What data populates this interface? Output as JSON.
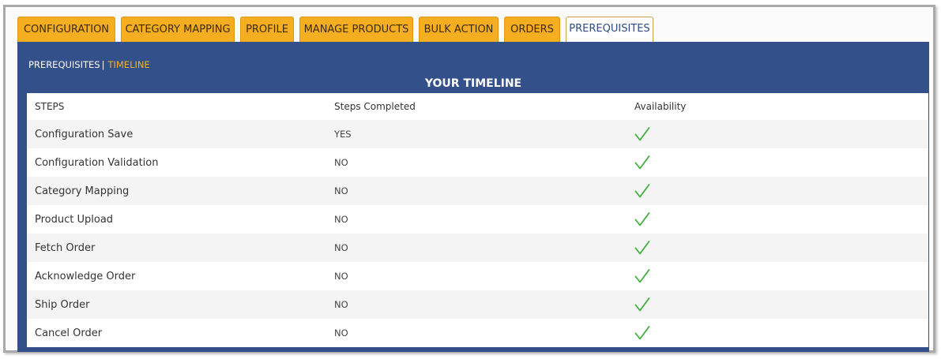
{
  "tabs": [
    {
      "label": "CONFIGURATION",
      "active": false
    },
    {
      "label": "CATEGORY MAPPING",
      "active": false
    },
    {
      "label": "PROFILE",
      "active": false
    },
    {
      "label": "MANAGE PRODUCTS",
      "active": false
    },
    {
      "label": "BULK ACTION",
      "active": false
    },
    {
      "label": "ORDERS",
      "active": false
    },
    {
      "label": "PREREQUISITES",
      "active": true
    }
  ],
  "subnav": {
    "prerequisites": "PREREQUISITES",
    "separator": "|",
    "timeline": "TIMELINE"
  },
  "panel": {
    "title": "YOUR TIMELINE"
  },
  "table": {
    "headers": [
      "STEPS",
      "Steps Completed",
      "Availability"
    ],
    "rows": [
      {
        "step": "Configuration Save",
        "completed": "YES",
        "availability_icon": "check-icon"
      },
      {
        "step": "Configuration Validation",
        "completed": "NO",
        "availability_icon": "check-icon"
      },
      {
        "step": "Category Mapping",
        "completed": "NO",
        "availability_icon": "check-icon"
      },
      {
        "step": "Product Upload",
        "completed": "NO",
        "availability_icon": "check-icon"
      },
      {
        "step": "Fetch Order",
        "completed": "NO",
        "availability_icon": "check-icon"
      },
      {
        "step": "Acknowledge Order",
        "completed": "NO",
        "availability_icon": "check-icon"
      },
      {
        "step": "Ship Order",
        "completed": "NO",
        "availability_icon": "check-icon"
      },
      {
        "step": "Cancel Order",
        "completed": "NO",
        "availability_icon": "check-icon"
      }
    ]
  },
  "colors": {
    "tab": "#f5ae20",
    "panel": "#34508a",
    "accent": "#f5b02a",
    "check": "#3fae3f"
  }
}
